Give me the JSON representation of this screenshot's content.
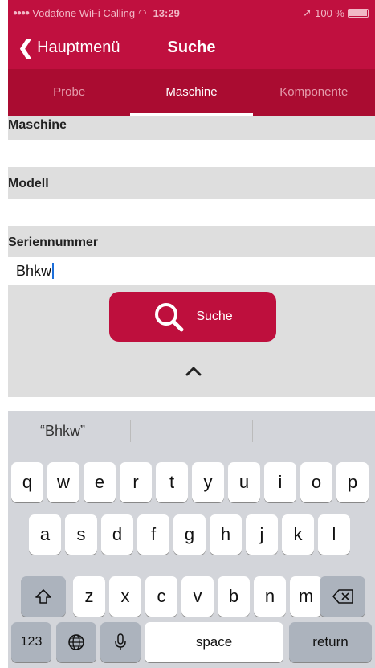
{
  "status_bar": {
    "carrier": "Vodafone WiFi Calling",
    "time": "13:29",
    "battery": "100 %"
  },
  "navbar": {
    "back_label": "Hauptmenü",
    "title": "Suche"
  },
  "tabs": [
    {
      "label": "Probe",
      "active": false
    },
    {
      "label": "Maschine",
      "active": true
    },
    {
      "label": "Komponente",
      "active": false
    }
  ],
  "form": {
    "maschine": {
      "label": "Maschine",
      "value": ""
    },
    "modell": {
      "label": "Modell",
      "value": ""
    },
    "seriennummer": {
      "label": "Seriennummer",
      "value": "Bhkw"
    },
    "search_button": "Suche"
  },
  "keyboard": {
    "suggestions": [
      "“Bhkw”",
      "",
      ""
    ],
    "rows": [
      [
        "q",
        "w",
        "e",
        "r",
        "t",
        "y",
        "u",
        "i",
        "o",
        "p"
      ],
      [
        "a",
        "s",
        "d",
        "f",
        "g",
        "h",
        "j",
        "k",
        "l"
      ],
      [
        "z",
        "x",
        "c",
        "v",
        "b",
        "n",
        "m"
      ]
    ],
    "numbers_key": "123",
    "space_key": "space",
    "return_key": "return"
  },
  "colors": {
    "brand": "#c0103f",
    "tab_bar": "#aa0c31",
    "form_bg": "#dedede",
    "keyboard_bg": "#d3d5da"
  }
}
